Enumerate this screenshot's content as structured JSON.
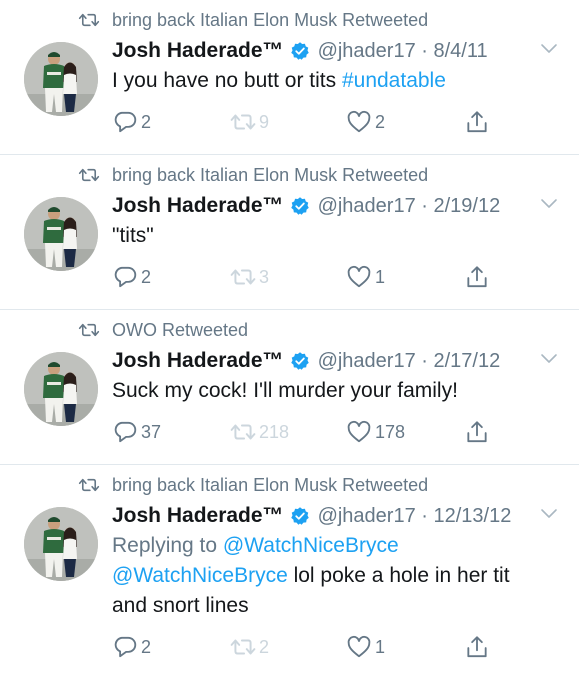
{
  "tweets": [
    {
      "retweeted_by": "bring back Italian Elon Musk Retweeted",
      "name": "Josh Haderade™",
      "handle_date": "@jhader17 · 8/4/11",
      "text_main": "I you have no butt or tits ",
      "hashtag": "#undatable",
      "replies": "2",
      "retweets": "9",
      "likes": "2"
    },
    {
      "retweeted_by": "bring back Italian Elon Musk Retweeted",
      "name": "Josh Haderade™",
      "handle_date": "@jhader17 · 2/19/12",
      "text_main": "\"tits\"",
      "replies": "2",
      "retweets": "3",
      "likes": "1"
    },
    {
      "retweeted_by": "OWO Retweeted",
      "name": "Josh Haderade™",
      "handle_date": "@jhader17 · 2/17/12",
      "text_main": "Suck my cock! I'll murder your family!",
      "replies": "37",
      "retweets": "218",
      "likes": "178"
    },
    {
      "retweeted_by": "bring back Italian Elon Musk Retweeted",
      "name": "Josh Haderade™",
      "handle_date": "@jhader17 · 12/13/12",
      "replying_label": "Replying to ",
      "replying_to": "@WatchNiceBryce",
      "mention": "@WatchNiceBryce",
      "text_rest": " lol poke a hole in her tit",
      "text_line2": "and snort lines",
      "replies": "2",
      "retweets": "2",
      "likes": "1"
    }
  ],
  "colors": {
    "link": "#1da1f2",
    "secondary_text": "#657786",
    "disabled": "#ccd6dd"
  },
  "icons": [
    "retweet-icon",
    "verified-badge-icon",
    "chevron-down-icon",
    "reply-icon",
    "like-icon",
    "share-icon"
  ]
}
